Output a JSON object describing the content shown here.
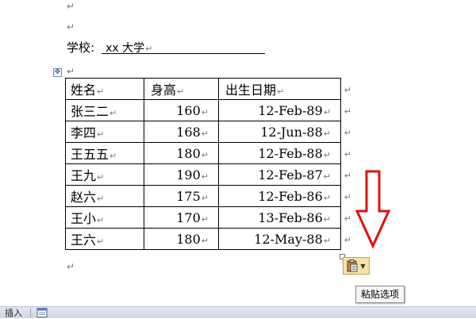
{
  "document": {
    "school_label": "学校:",
    "school_value": "xx 大学",
    "paragraph_mark": "↵",
    "table": {
      "headers": [
        "姓名",
        "身高",
        "出生日期"
      ],
      "rows": [
        [
          "张三二",
          "160",
          "12-Feb-89"
        ],
        [
          "李四",
          "168",
          "12-Jun-88"
        ],
        [
          "王五五",
          "180",
          "12-Feb-88"
        ],
        [
          "王九",
          "190",
          "12-Feb-87"
        ],
        [
          "赵六",
          "175",
          "12-Feb-86"
        ],
        [
          "王小",
          "170",
          "13-Feb-86"
        ],
        [
          "王六",
          "180",
          "12-May-88"
        ]
      ]
    }
  },
  "paste_options": {
    "tooltip": "粘贴选项",
    "icon": "clipboard-icon",
    "button_color": "#f7e3a8"
  },
  "annotation": {
    "arrow_color": "#e01010",
    "arrow_icon": "down-arrow-icon"
  },
  "status_bar": {
    "insert_label": "插入",
    "view_icon": "document-view-icon"
  }
}
